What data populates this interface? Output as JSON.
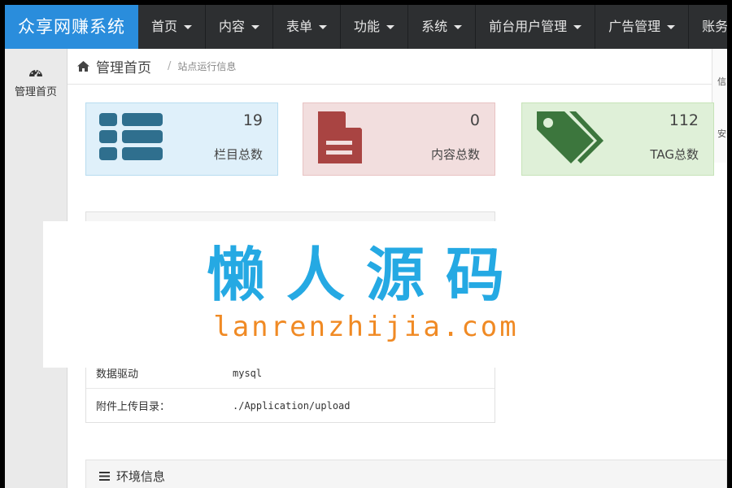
{
  "brand": "众享网赚系统",
  "nav": {
    "items": [
      "首页",
      "内容",
      "表单",
      "功能",
      "系统",
      "前台用户管理",
      "广告管理",
      "账务管理"
    ]
  },
  "sidebar": {
    "items": [
      {
        "label": "管理首页"
      }
    ]
  },
  "breadcrumb": {
    "home": "管理首页",
    "sub": "站点运行信息"
  },
  "right_strip": {
    "chars": [
      "信",
      "安"
    ]
  },
  "stats": [
    {
      "value": "19",
      "label": "栏目总数",
      "icon": "list-icon",
      "color": "#2f6f8e"
    },
    {
      "value": "0",
      "label": "内容总数",
      "icon": "file-icon",
      "color": "#a94442"
    },
    {
      "value": "112",
      "label": "TAG总数",
      "icon": "tags-icon",
      "color": "#3c763d"
    }
  ],
  "info_rows": [
    {
      "key": "数据驱动",
      "value": "mysql"
    },
    {
      "key": "附件上传目录：",
      "value": "./Application/upload"
    }
  ],
  "env": {
    "title": "环境信息"
  },
  "watermark": {
    "cn": "懒人源码",
    "en": "lanrenzhijia.com"
  }
}
